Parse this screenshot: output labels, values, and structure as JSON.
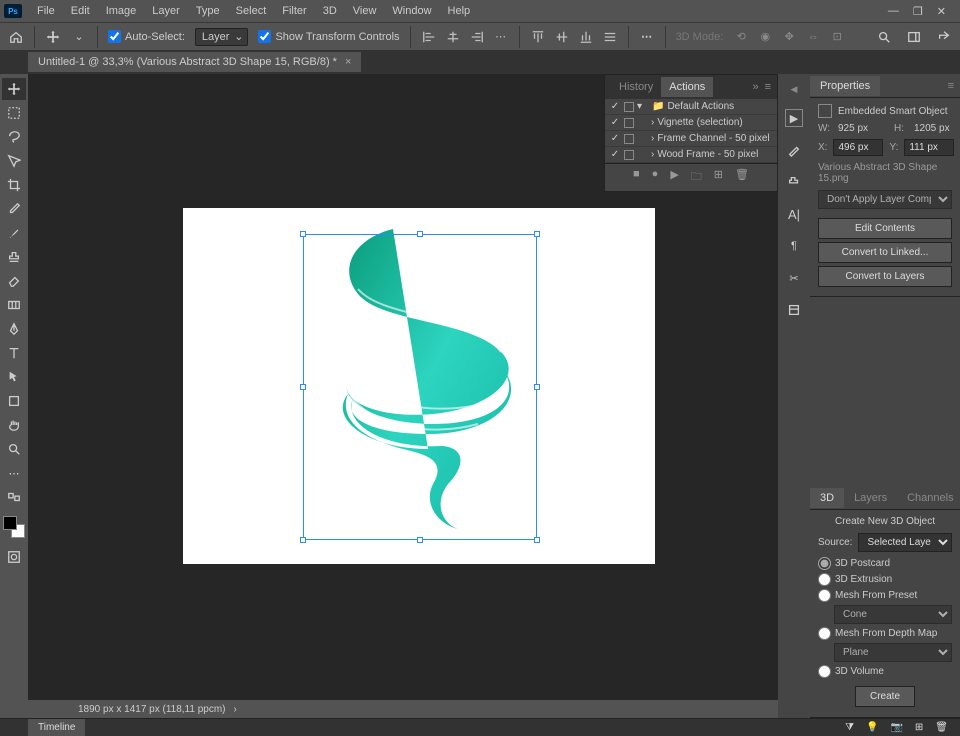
{
  "menu": [
    "File",
    "Edit",
    "Image",
    "Layer",
    "Type",
    "Select",
    "Filter",
    "3D",
    "View",
    "Window",
    "Help"
  ],
  "optbar": {
    "autoselect": "Auto-Select:",
    "layer": "Layer",
    "showtransform": "Show Transform Controls",
    "mode3d": "3D Mode:"
  },
  "doctab": {
    "title": "Untitled-1 @ 33,3% (Various Abstract 3D Shape 15, RGB/8) *"
  },
  "actions": {
    "tabs": [
      "History",
      "Actions"
    ],
    "items": [
      {
        "label": "Default Actions",
        "folder": true
      },
      {
        "label": "Vignette (selection)"
      },
      {
        "label": "Frame Channel - 50 pixel"
      },
      {
        "label": "Wood Frame - 50 pixel"
      }
    ]
  },
  "properties": {
    "title": "Properties",
    "type": "Embedded Smart Object",
    "W": "925 px",
    "H": "1205 px",
    "X": "496 px",
    "Y": "111 px",
    "file": "Various Abstract 3D Shape 15.png",
    "layercomp": "Don't Apply Layer Comp",
    "buttons": [
      "Edit Contents",
      "Convert to Linked...",
      "Convert to Layers"
    ]
  },
  "panel3d": {
    "tabs": [
      "3D",
      "Layers",
      "Channels"
    ],
    "header": "Create New 3D Object",
    "source_label": "Source:",
    "source": "Selected Layer(s)",
    "options": [
      "3D Postcard",
      "3D Extrusion",
      "Mesh From Preset",
      "Mesh From Depth Map",
      "3D Volume"
    ],
    "preset1": "Cone",
    "preset2": "Plane",
    "create": "Create"
  },
  "statusbar": "1890 px x 1417 px (118,11 ppcm)",
  "timeline": "Timeline"
}
